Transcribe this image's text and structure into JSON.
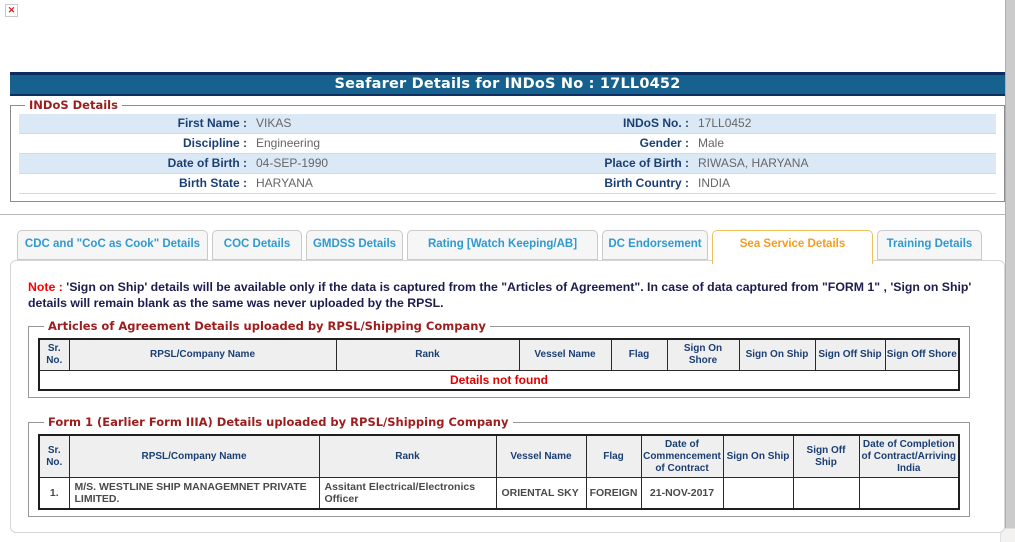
{
  "window": {
    "title_bar": "Seafarer Details for INDoS No : 17LL0452"
  },
  "icons": {
    "broken_image": "✕"
  },
  "indos_details": {
    "legend": "INDoS Details",
    "rows": [
      {
        "l_label": "First Name :",
        "l_value": "VIKAS",
        "r_label": "INDoS No. :",
        "r_value": "17LL0452"
      },
      {
        "l_label": "Discipline :",
        "l_value": "Engineering",
        "r_label": "Gender :",
        "r_value": "Male"
      },
      {
        "l_label": "Date of Birth :",
        "l_value": "04-SEP-1990",
        "r_label": "Place of Birth :",
        "r_value": "RIWASA, HARYANA"
      },
      {
        "l_label": "Birth State :",
        "l_value": "HARYANA",
        "r_label": "Birth Country :",
        "r_value": "INDIA"
      }
    ]
  },
  "tabs": [
    {
      "label": "CDC and \"CoC as Cook\" Details",
      "active": false
    },
    {
      "label": "COC Details",
      "active": false
    },
    {
      "label": "GMDSS Details",
      "active": false
    },
    {
      "label": "Rating [Watch Keeping/AB]",
      "active": false
    },
    {
      "label": "DC Endorsement",
      "active": false
    },
    {
      "label": "Sea Service Details",
      "active": true
    },
    {
      "label": "Training Details",
      "active": false
    }
  ],
  "note": {
    "prefix": "Note :",
    "body": "'Sign on Ship' details will be available only if the data is captured from the \"Articles of Agreement\". In case of data captured from \"FORM 1\" , 'Sign on Ship' details will remain blank as the same was never uploaded by the RPSL."
  },
  "articles_table": {
    "legend": "Articles of Agreement Details uploaded by RPSL/Shipping Company",
    "headers": [
      "Sr. No.",
      "RPSL/Company Name",
      "Rank",
      "Vessel Name",
      "Flag",
      "Sign On Shore",
      "Sign On Ship",
      "Sign Off Ship",
      "Sign Off Shore"
    ],
    "empty_message": "Details not found"
  },
  "form1_table": {
    "legend": "Form 1 (Earlier Form IIIA) Details uploaded by RPSL/Shipping Company",
    "headers": [
      "Sr. No.",
      "RPSL/Company Name",
      "Rank",
      "Vessel Name",
      "Flag",
      "Date of Commencement of Contract",
      "Sign On Ship",
      "Sign Off Ship",
      "Date of Completion of Contract/Arriving India"
    ],
    "rows": [
      [
        "1.",
        "M/S. WESTLINE SHIP MANAGEMNET PRIVATE LIMITED.",
        "Assitant Electrical/Electronics Officer",
        "ORIENTAL SKY",
        "FOREIGN",
        "21-NOV-2017",
        "",
        "",
        ""
      ]
    ]
  },
  "colors": {
    "title_bar_bg": "#16618E",
    "title_bar_border": "#0B2D5F",
    "legend_text": "#9C1D1D",
    "field_label": "#1B3F74",
    "field_value": "#666666",
    "row_stripe": "#DBE9F7",
    "tab_inactive_text": "#2E9AD0",
    "tab_active_text": "#F59D1E",
    "tab_active_border": "#F2BF5E",
    "note_prefix": "#FF0000",
    "note_body": "#1C1C4F",
    "table_header_bg": "#EFEFEF",
    "table_header_text": "#1B3F74",
    "empty_message_text": "#E00000"
  }
}
